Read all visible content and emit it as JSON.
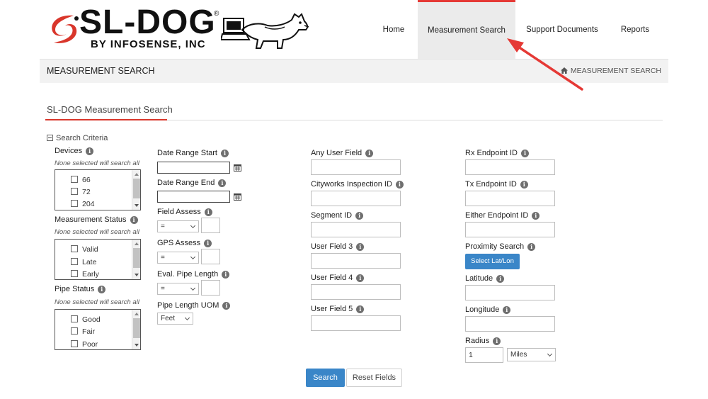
{
  "brand": {
    "name": "SL-DOG",
    "subtitle": "BY INFOSENSE, INC",
    "registered": "®"
  },
  "nav": {
    "home": "Home",
    "measurement_search": "Measurement Search",
    "support_documents": "Support Documents",
    "reports": "Reports"
  },
  "banner": {
    "title": "MEASUREMENT SEARCH",
    "breadcrumb": "MEASUREMENT SEARCH"
  },
  "section": {
    "title": "SL-DOG Measurement Search",
    "criteria": "Search Criteria"
  },
  "left_column": {
    "devices": {
      "label": "Devices",
      "hint": "None selected will search all",
      "options": [
        "66",
        "72",
        "204"
      ]
    },
    "measurement_status": {
      "label": "Measurement Status",
      "hint": "None selected will search all",
      "options": [
        "Valid",
        "Late",
        "Early"
      ]
    },
    "pipe_status": {
      "label": "Pipe Status",
      "hint": "None selected will search all",
      "options": [
        "Good",
        "Fair",
        "Poor"
      ]
    }
  },
  "col2": {
    "date_range_start": "Date Range Start",
    "date_range_end": "Date Range End",
    "field_assess": "Field Assess",
    "field_assess_value": "=",
    "gps_assess": "GPS Assess",
    "gps_assess_value": "=",
    "eval_pipe_length": "Eval. Pipe Length",
    "eval_pipe_length_value": "=",
    "pipe_length_uom": "Pipe Length UOM",
    "pipe_length_uom_value": "Feet"
  },
  "col3": {
    "fields": [
      "Any User Field",
      "Cityworks Inspection ID",
      "Segment ID",
      "User Field 3",
      "User Field 4",
      "User Field 5"
    ]
  },
  "col4": {
    "rx_endpoint_id": "Rx Endpoint ID",
    "tx_endpoint_id": "Tx Endpoint ID",
    "either_endpoint_id": "Either Endpoint ID",
    "proximity_search": "Proximity Search",
    "select_latlon_button": "Select Lat/Lon",
    "latitude": "Latitude",
    "longitude": "Longitude",
    "radius": "Radius",
    "radius_value": "1",
    "radius_unit": "Miles"
  },
  "actions": {
    "search": "Search",
    "reset": "Reset Fields"
  },
  "colors": {
    "accent_red": "#e53935",
    "button_blue": "#3a86c8"
  }
}
